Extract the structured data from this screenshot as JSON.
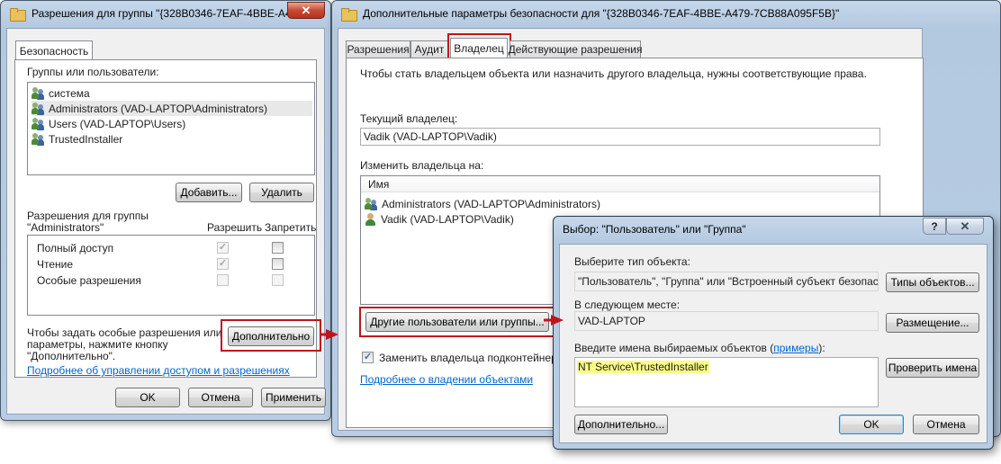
{
  "win1": {
    "title": "Разрешения для группы \"{328B0346-7EAF-4BBE-A4...",
    "close": "✕",
    "tab": "Безопасность",
    "groups_label": "Группы или пользователи:",
    "groups": [
      "система",
      "Administrators (VAD-LAPTOP\\Administrators)",
      "Users (VAD-LAPTOP\\Users)",
      "TrustedInstaller"
    ],
    "add_btn": "Добавить...",
    "remove_btn": "Удалить",
    "perms_for": "Разрешения для группы",
    "perms_group": "\"Administrators\"",
    "allow_col": "Разрешить",
    "deny_col": "Запретить",
    "perms": [
      {
        "name": "Полный доступ",
        "allow": "✓",
        "deny": ""
      },
      {
        "name": "Чтение",
        "allow": "✓",
        "deny": ""
      },
      {
        "name": "Особые разрешения",
        "allow": "",
        "deny": ""
      }
    ],
    "special_text_1": "Чтобы задать особые разрешения или",
    "special_text_2": "параметры, нажмите кнопку",
    "special_text_3": "\"Дополнительно\".",
    "advanced_btn": "Дополнительно",
    "help_link": "Подробнее об управлении доступом и разрешениях",
    "ok_btn": "OK",
    "cancel_btn": "Отмена",
    "apply_btn": "Применить"
  },
  "win2": {
    "title": "Дополнительные параметры безопасности  для \"{328B0346-7EAF-4BBE-A479-7CB88A095F5B}\"",
    "tabs": [
      "Разрешения",
      "Аудит",
      "Владелец",
      "Действующие разрешения"
    ],
    "info_text": "Чтобы стать владельцем объекта или назначить другого владельца, нужны соответствующие права.",
    "current_owner_label": "Текущий владелец:",
    "current_owner": "Vadik (VAD-LAPTOP\\Vadik)",
    "change_owner_label": "Изменить владельца на:",
    "name_col": "Имя",
    "owners": [
      "Administrators (VAD-LAPTOP\\Administrators)",
      "Vadik (VAD-LAPTOP\\Vadik)"
    ],
    "other_users_btn": "Другие пользователи или группы...",
    "replace_owner": "Заменить владельца подконтейнеров и",
    "replace_check": "✓",
    "owner_link": "Подробнее о владении объектами"
  },
  "win3": {
    "title": "Выбор: \"Пользователь\" или \"Группа\"",
    "help": "?",
    "close": "✕",
    "obj_type_label": "Выберите тип объекта:",
    "obj_type": "\"Пользователь\", \"Группа\" или \"Встроенный субъект безопасност",
    "obj_types_btn": "Типы объектов...",
    "location_label": "В следующем месте:",
    "location": "VAD-LAPTOP",
    "location_btn": "Размещение...",
    "names_label_pre": "Введите имена выбираемых объектов (",
    "names_label_link": "примеры",
    "names_label_post": "):",
    "names_value": "NT Service\\TrustedInstaller",
    "check_names_btn": "Проверить имена",
    "advanced_btn": "Дополнительно...",
    "ok_btn": "OK",
    "cancel_btn": "Отмена"
  },
  "colors": {
    "highlight_box": "#c0141c",
    "arrow": "#c0141c",
    "link": "#0066cc",
    "name_highlight": "#fbfb8a"
  }
}
